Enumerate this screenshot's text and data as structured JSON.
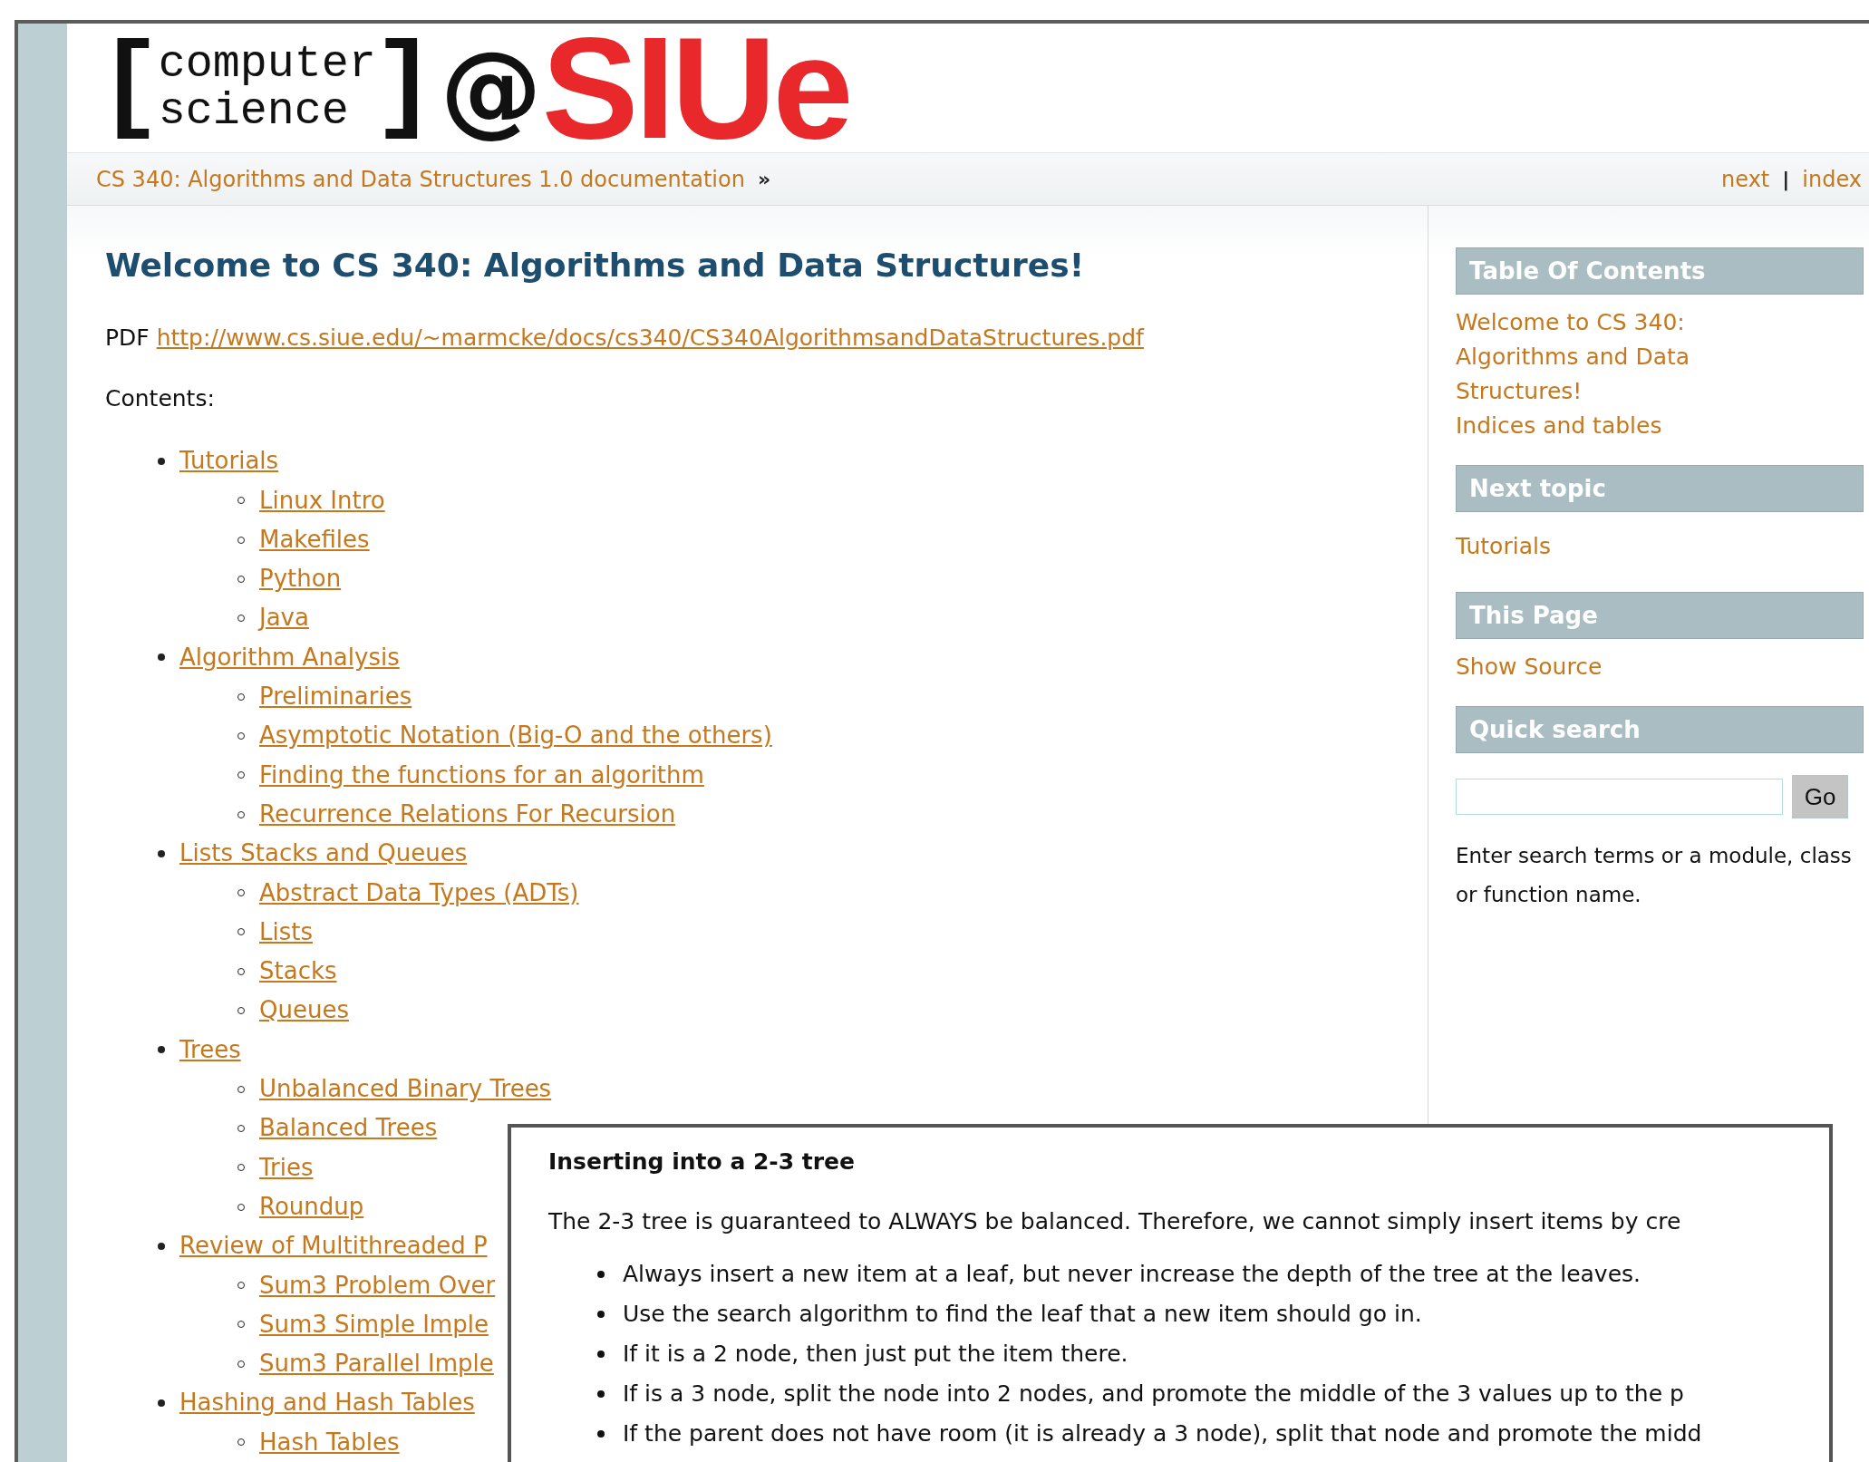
{
  "logo": {
    "bracket_open": "[",
    "line_1": "computer",
    "line_2": "science",
    "bracket_close": "]",
    "at": "@",
    "name": "SIUe"
  },
  "breadcrumb": {
    "home": "CS 340: Algorithms and Data Structures 1.0 documentation",
    "separator": "»",
    "links": [
      "next",
      "index"
    ],
    "divider": "|"
  },
  "main": {
    "title": "Welcome to CS 340: Algorithms and Data Structures!",
    "pdf_label": "PDF",
    "pdf_link": "http://www.cs.siue.edu/~marmcke/docs/cs340/CS340AlgorithmsandDataStructures.pdf",
    "contents_label": "Contents:",
    "toc": [
      {
        "label": "Tutorials",
        "children": [
          {
            "label": "Linux Intro"
          },
          {
            "label": "Makefiles"
          },
          {
            "label": "Python"
          },
          {
            "label": "Java"
          }
        ]
      },
      {
        "label": "Algorithm Analysis",
        "children": [
          {
            "label": "Preliminaries"
          },
          {
            "label": "Asymptotic Notation (Big-O and the others)"
          },
          {
            "label": "Finding the functions for an algorithm"
          },
          {
            "label": "Recurrence Relations For Recursion"
          }
        ]
      },
      {
        "label": "Lists Stacks and Queues",
        "children": [
          {
            "label": "Abstract Data Types (ADTs)"
          },
          {
            "label": "Lists"
          },
          {
            "label": "Stacks"
          },
          {
            "label": "Queues"
          }
        ]
      },
      {
        "label": "Trees",
        "children": [
          {
            "label": "Unbalanced Binary Trees"
          },
          {
            "label": "Balanced Trees"
          },
          {
            "label": "Tries"
          },
          {
            "label": "Roundup"
          }
        ]
      },
      {
        "label": "Review of Multithreaded P",
        "children": [
          {
            "label": "Sum3 Problem Over"
          },
          {
            "label": "Sum3 Simple Imple"
          },
          {
            "label": "Sum3 Parallel Imple"
          }
        ]
      },
      {
        "label": "Hashing and Hash Tables",
        "children": [
          {
            "label": "Hash Tables"
          }
        ]
      }
    ]
  },
  "sidebar": {
    "sections": [
      {
        "heading": "Table Of Contents",
        "links": [
          "Welcome to CS 340: Algorithms and Data Structures!",
          "Indices and tables"
        ]
      },
      {
        "heading": "Next topic",
        "links": [
          "Tutorials"
        ]
      },
      {
        "heading": "This Page",
        "links": [
          "Show Source"
        ]
      },
      {
        "heading": "Quick search"
      }
    ],
    "search_button": "Go",
    "search_help": "Enter search terms or a module, class or function name."
  },
  "overlay": {
    "title": "Inserting into a 2-3 tree",
    "paragraph": "The 2-3 tree is guaranteed to ALWAYS be balanced. Therefore, we cannot simply insert items by cre",
    "bullets": [
      "Always insert a new item at a leaf, but never increase the depth of the tree at the leaves.",
      "Use the search algorithm to find the leaf that a new item should go in.",
      "If it is a 2 node, then just put the item there.",
      "If is a 3 node, split the node into 2 nodes, and promote the middle of the 3 values up to the p",
      "If the parent does not have room (it is already a 3 node), split that node and promote the midd"
    ]
  }
}
